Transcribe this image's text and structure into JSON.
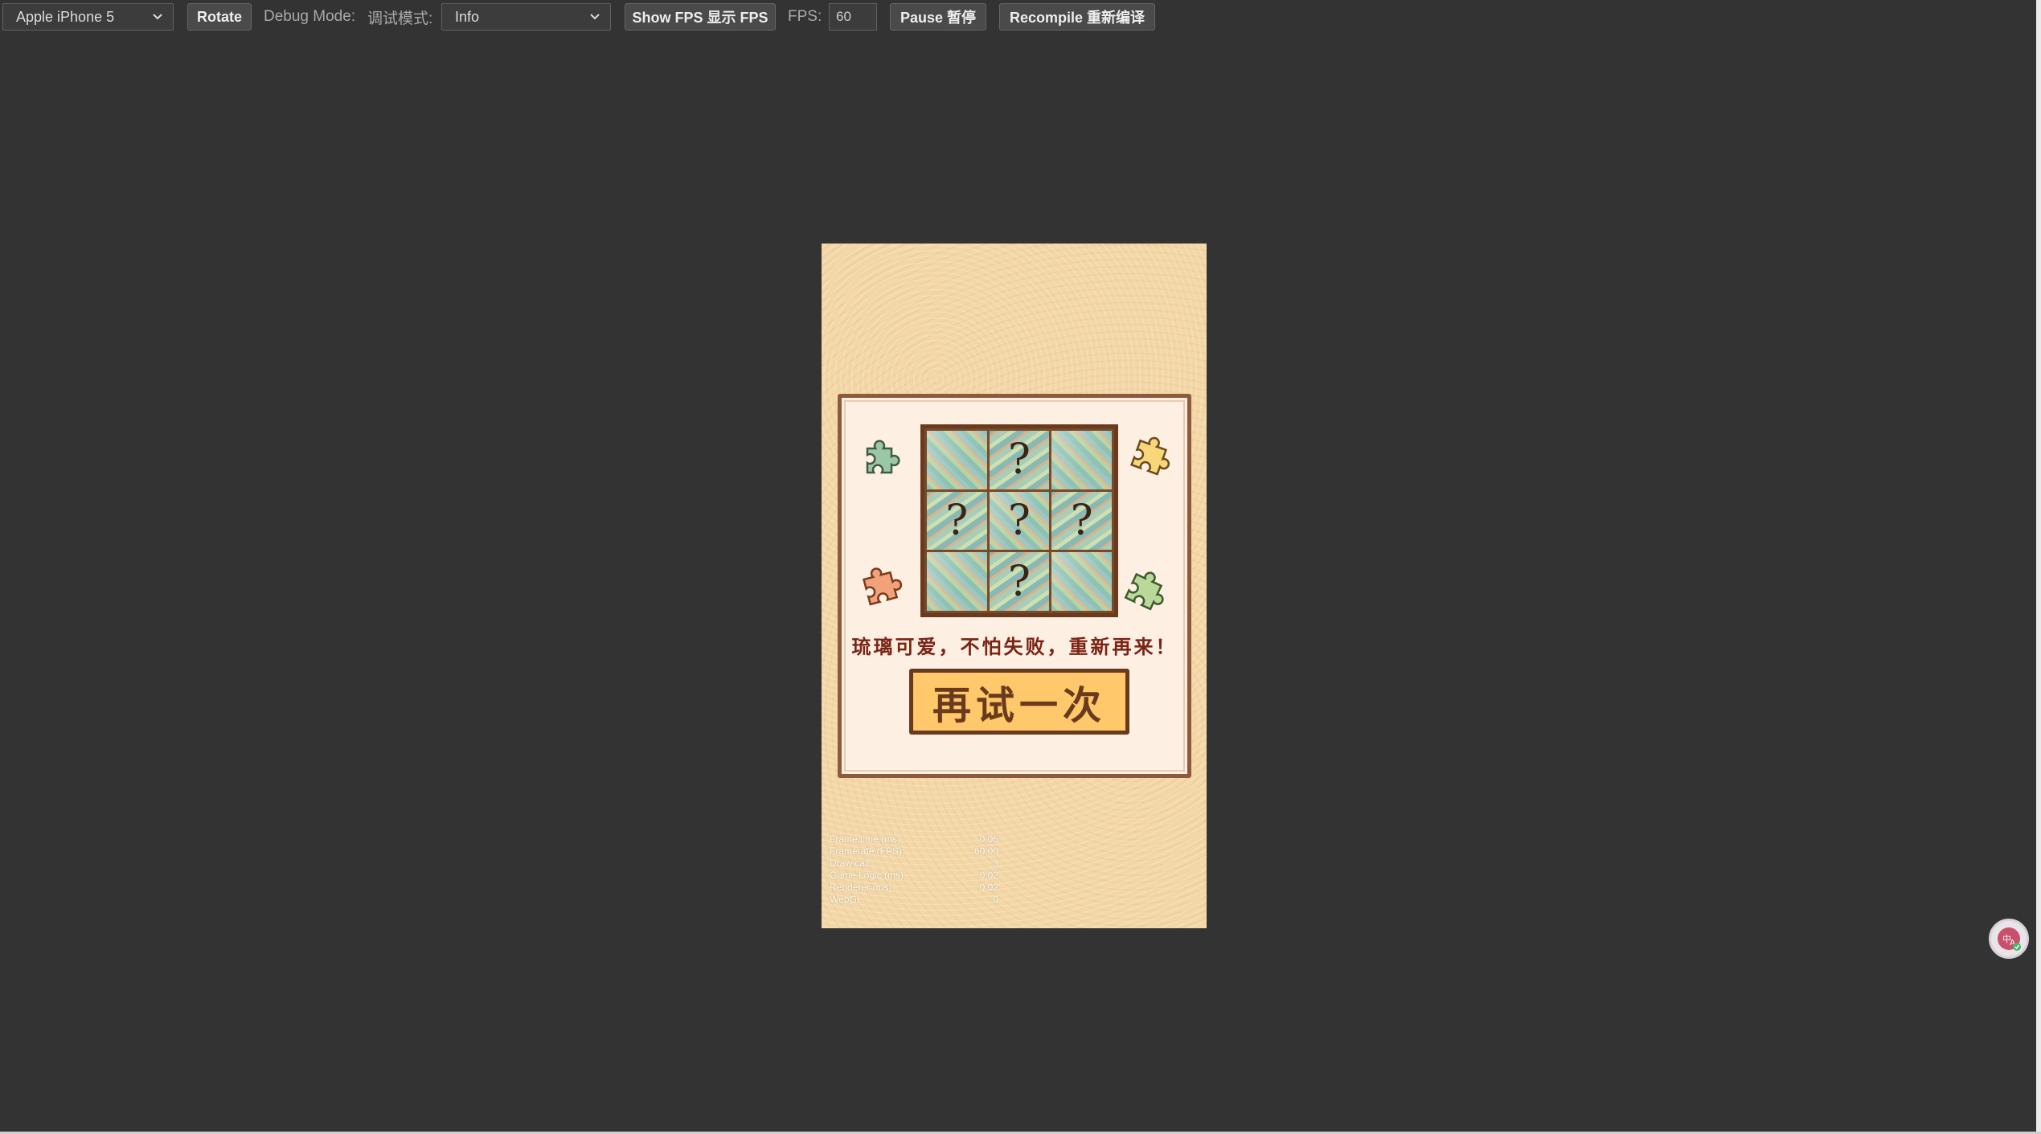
{
  "toolbar": {
    "device_select": "Apple iPhone 5",
    "rotate": "Rotate",
    "debug_mode_label": "Debug Mode:",
    "debug_mode_label_cn": "调试模式:",
    "debug_mode_value": "Info",
    "show_fps": "Show FPS 显示 FPS",
    "fps_label": "FPS:",
    "fps_value": "60",
    "pause": "Pause 暂停",
    "recompile": "Recompile 重新编译"
  },
  "game": {
    "puzzle_cells": [
      "",
      "?",
      "",
      "?",
      "?",
      "?",
      "",
      "?",
      ""
    ],
    "message": "琉璃可爱，不怕失败，重新再来！",
    "retry_button": "再试一次"
  },
  "stats": [
    {
      "label": "Frame time (ms)",
      "value": "0.05"
    },
    {
      "label": "Framerate (FPS)",
      "value": "60.00"
    },
    {
      "label": "Draw call",
      "value": "3"
    },
    {
      "label": "Game Logic (ms)",
      "value": "0.02"
    },
    {
      "label": "Renderer (ms)",
      "value": "0.02"
    },
    {
      "label": "WebGL",
      "value": "0"
    }
  ],
  "colors": {
    "background": "#333333",
    "canvas": "#f3d7a6",
    "panel_border": "#8d5a3e",
    "button_fill": "#ffc86a",
    "message_text": "#7a2416"
  },
  "icons": {
    "float_button": "translate-icon"
  }
}
